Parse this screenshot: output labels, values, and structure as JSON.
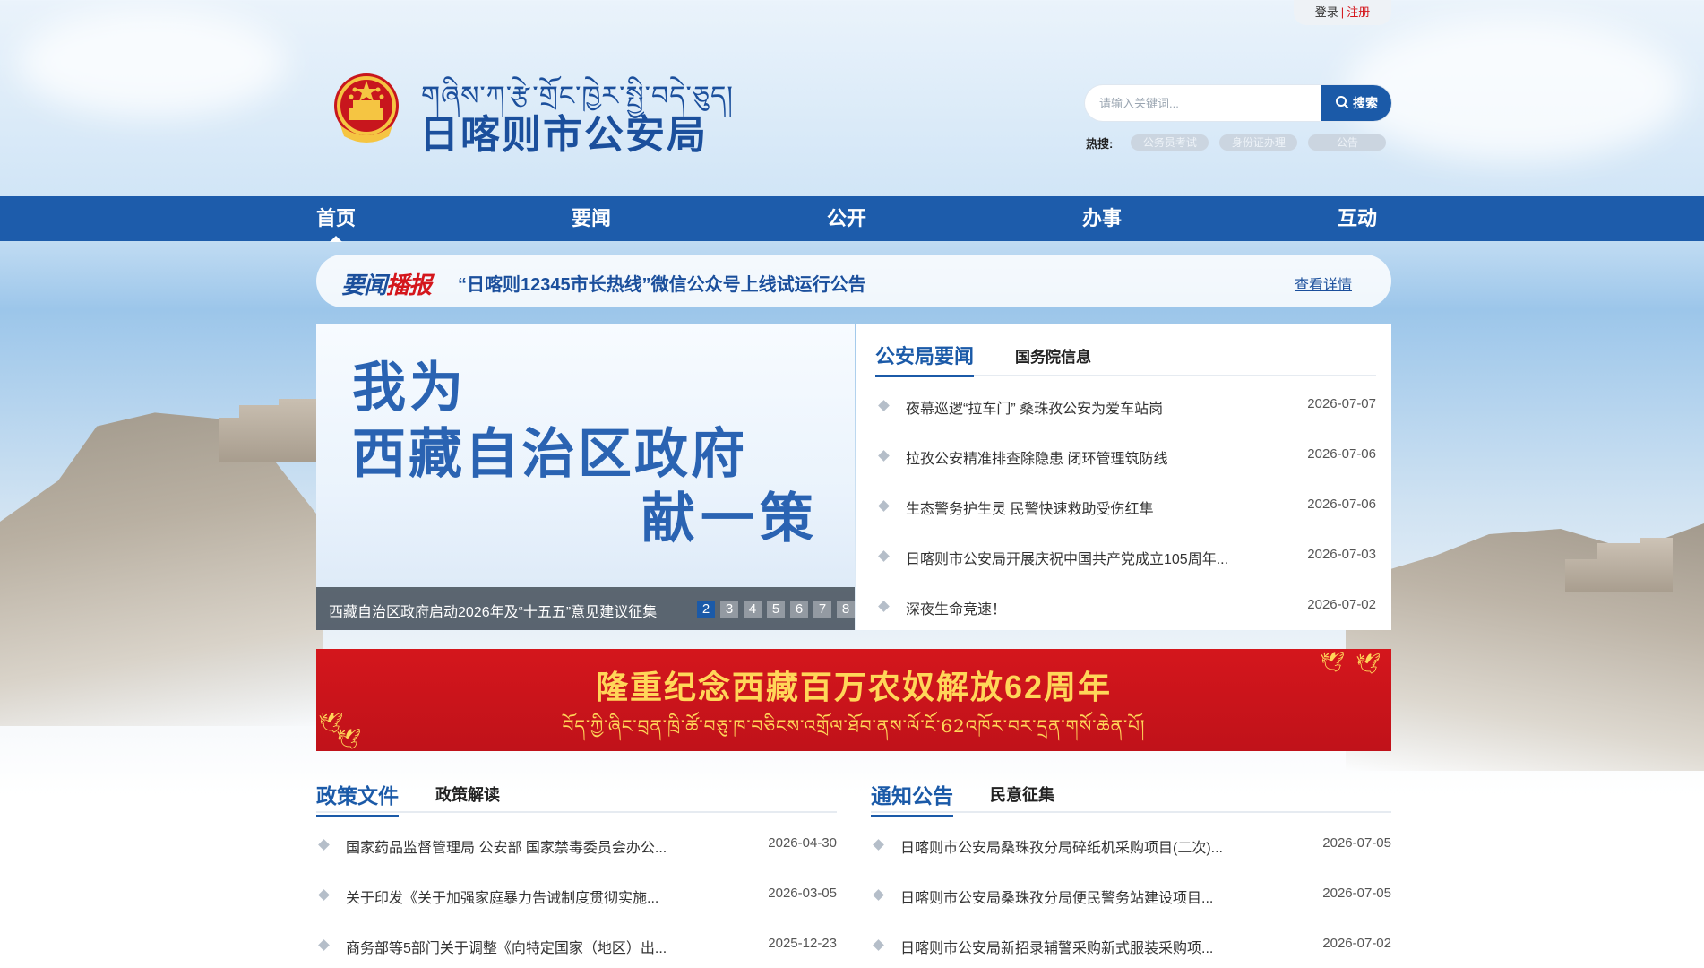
{
  "auth": {
    "login": "登录",
    "register": "注册",
    "separator": "|"
  },
  "header": {
    "tibetan_title": "གཞིས་ཀ་རྩེ་གྲོང་ཁྱེར་སྤྱི་བདེ་ཅུད།",
    "title": "日喀则市公安局"
  },
  "search": {
    "placeholder": "请输入关键词...",
    "button_label": "搜索",
    "hot_label": "热搜:",
    "hot_tags": [
      "公务员考试",
      "身份证办理",
      "公告"
    ]
  },
  "nav": {
    "items": [
      {
        "label": "首页",
        "active": true
      },
      {
        "label": "要闻"
      },
      {
        "label": "公开"
      },
      {
        "label": "办事"
      },
      {
        "label": "互动"
      }
    ]
  },
  "ticker": {
    "logo_blue": "要闻",
    "logo_red": "播报",
    "text": "“日喀则12345市长热线”微信公众号上线试运行公告",
    "more": "查看详情"
  },
  "slide": {
    "line1": "我为",
    "line2": "西藏自治区政府",
    "line3": "献一策",
    "caption": "西藏自治区政府启动2026年及“十五五”意见建议征集",
    "dots": [
      "2",
      "3",
      "4",
      "5",
      "6",
      "7",
      "8"
    ],
    "active_dot": "2"
  },
  "news": {
    "tab_main": "公安局要闻",
    "tab_sub": "国务院信息",
    "items": [
      {
        "title": "夜幕巡逻“拉车门” 桑珠孜公安为爱车站岗",
        "date": "2026-07-07"
      },
      {
        "title": "拉孜公安精准排查除隐患 闭环管理筑防线",
        "date": "2026-07-06"
      },
      {
        "title": "生态警务护生灵 民警快速救助受伤红隼",
        "date": "2026-07-06"
      },
      {
        "title": "日喀则市公安局开展庆祝中国共产党成立105周年...",
        "date": "2026-07-03"
      },
      {
        "title": "深夜生命竞速！",
        "date": "2026-07-02"
      }
    ]
  },
  "banner": {
    "title": "隆重纪念西藏百万农奴解放62周年",
    "subtitle": "བོད་ཀྱི་ཞིང་བྲན་ཁྲི་ཚོ་བཅུ་ཁ་བཅིངས་འགྲོལ་ཐོབ་ནས་ལོ་ངོ་62འཁོར་བར་དྲན་གསོ་ཆེན་པོ།"
  },
  "policy": {
    "tab_main": "政策文件",
    "tab_sub": "政策解读",
    "items": [
      {
        "title": "国家药品监督管理局 公安部 国家禁毒委员会办公...",
        "date": "2026-04-30"
      },
      {
        "title": "关于印发《关于加强家庭暴力告诫制度贯彻实施...",
        "date": "2026-03-05"
      },
      {
        "title": "商务部等5部门关于调整《向特定国家（地区）出...",
        "date": "2025-12-23"
      }
    ]
  },
  "notice": {
    "tab_main": "通知公告",
    "tab_sub": "民意征集",
    "items": [
      {
        "title": "日喀则市公安局桑珠孜分局碎纸机采购项目(二次)...",
        "date": "2026-07-05"
      },
      {
        "title": "日喀则市公安局桑珠孜分局便民警务站建设项目...",
        "date": "2026-07-05"
      },
      {
        "title": "日喀则市公安局新招录辅警采购新式服装采购项...",
        "date": "2026-07-02"
      }
    ]
  },
  "colors": {
    "brand_blue": "#1d5cab",
    "accent_red": "#d4161c",
    "banner_gold": "#ffd659"
  }
}
